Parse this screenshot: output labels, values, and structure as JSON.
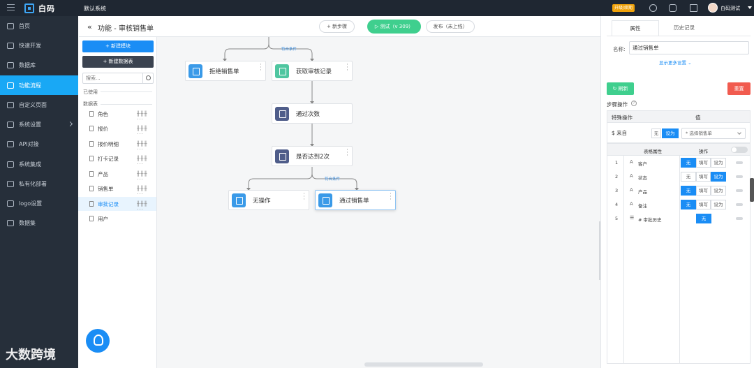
{
  "topbar": {
    "brand": "白码",
    "system_name": "默认系统",
    "upgrade_label": "升级/续期",
    "user_name": "白码测试"
  },
  "sidebar": {
    "items": [
      {
        "label": "首页",
        "icon": "home-icon"
      },
      {
        "label": "快速开发",
        "icon": "rocket-icon"
      },
      {
        "label": "数据库",
        "icon": "database-icon"
      },
      {
        "label": "功能流程",
        "icon": "flow-icon",
        "active": true
      },
      {
        "label": "自定义页面",
        "icon": "page-icon"
      },
      {
        "label": "系统设置",
        "icon": "settings-icon"
      },
      {
        "label": "API对接",
        "icon": "api-icon"
      },
      {
        "label": "系统集成",
        "icon": "integration-icon"
      },
      {
        "label": "私有化部署",
        "icon": "server-icon"
      },
      {
        "label": "logo设置",
        "icon": "logo-icon"
      },
      {
        "label": "数据集",
        "icon": "dataset-icon"
      }
    ]
  },
  "listpanel": {
    "new_module": "新建模块",
    "new_table": "新建数据表",
    "search_placeholder": "搜索...",
    "used_label": "已使用",
    "table_label": "数据表",
    "tables": [
      "角色",
      "报价",
      "报价明细",
      "打卡记录",
      "产品",
      "销售单",
      "审批记录",
      "用户"
    ],
    "active_table": "审批记录"
  },
  "canvas": {
    "title": "功能 - 审核销售单",
    "new_step": "+ 新步骤",
    "test_button": "测试（v 309）",
    "publish_button": "发布（未上线）",
    "condition_label": "符合条件",
    "nodes": {
      "reject": "拒绝销售单",
      "fetch": "获取审核记录",
      "count": "通过次数",
      "check": "是否达到2次",
      "noop": "无操作",
      "approve": "通过销售单"
    }
  },
  "rpanel": {
    "tab_attrs": "属性",
    "tab_history": "历史记录",
    "name_label": "名称:",
    "name_value": "通过销售单",
    "more_settings": "显示更多设置",
    "refresh": "刷新",
    "reset": "重置",
    "step_ops": "步骤操作",
    "ops_header_special": "特殊操作",
    "ops_header_value": "值",
    "source_label": "$ 来自",
    "seg_none": "无",
    "seg_set": "设为",
    "select_value": "* 选择销售单",
    "attr_header_prop": "表格属性",
    "attr_header_op": "操作",
    "seg_fill": "填写",
    "attrs": [
      {
        "no": "1",
        "name": "客户",
        "icon": "text-icon",
        "state": "none"
      },
      {
        "no": "2",
        "name": "状态",
        "icon": "text-icon",
        "state": "set"
      },
      {
        "no": "3",
        "name": "产品",
        "icon": "text-icon",
        "state": "none"
      },
      {
        "no": "4",
        "name": "备注",
        "icon": "text-icon",
        "state": "none"
      },
      {
        "no": "5",
        "name": "# 审批历史",
        "icon": "list-icon",
        "state": "only"
      }
    ]
  },
  "watermark": "大数跨境",
  "colors": {
    "accent": "#1a8df5",
    "green": "#3fcf8e",
    "red": "#f15b4f",
    "sidebar": "#262f3a",
    "topbar": "#1f2732"
  }
}
